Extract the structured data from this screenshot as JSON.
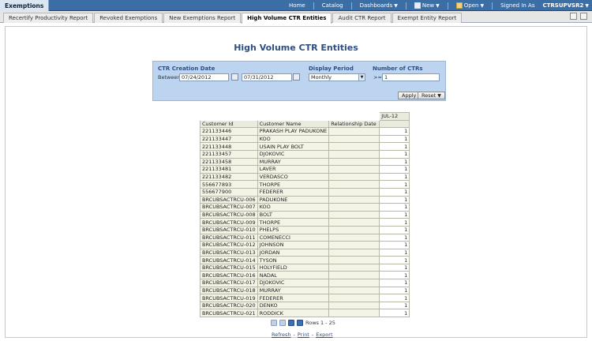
{
  "header": {
    "app_tab": "Exemptions",
    "nav": {
      "home": "Home",
      "catalog": "Catalog",
      "dashboards": "Dashboards",
      "new": "New",
      "open": "Open",
      "signed_in_as": "Signed In As",
      "user": "CTRSUPVSR2"
    }
  },
  "tabs": [
    {
      "label": "Recertify Productivity Report"
    },
    {
      "label": "Revoked Exemptions"
    },
    {
      "label": "New Exemptions Report"
    },
    {
      "label": "High Volume CTR Entities"
    },
    {
      "label": "Audit CTR Report"
    },
    {
      "label": "Exempt Entity Report"
    }
  ],
  "active_tab": "High Volume CTR Entities",
  "page": {
    "title": "High Volume CTR Entities"
  },
  "filters": {
    "ctr_date_label": "CTR Creation Date",
    "between_label": "Between",
    "date_from": "07/24/2012",
    "date_to": "07/31/2012",
    "display_period_label": "Display Period",
    "display_period_value": "Monthly",
    "num_ctrs_label": "Number of CTRs",
    "num_ctrs_op": ">=",
    "num_ctrs_value": "1",
    "apply_label": "Apply",
    "reset_label": "Reset"
  },
  "table": {
    "period_header": "JUL-12",
    "columns": [
      "Customer Id",
      "Customer Name",
      "Relationship Date"
    ],
    "rows": [
      [
        "221133446",
        "PRAKASH PLAY PADUKONE",
        "",
        "1"
      ],
      [
        "221133447",
        "KOO",
        "",
        "1"
      ],
      [
        "221133448",
        "USAIN PLAY BOLT",
        "",
        "1"
      ],
      [
        "221133457",
        "DJOKOVIC",
        "",
        "1"
      ],
      [
        "221133458",
        "MURRAY",
        "",
        "1"
      ],
      [
        "221133481",
        "LAVER",
        "",
        "1"
      ],
      [
        "221133482",
        "VERDASCO",
        "",
        "1"
      ],
      [
        "556677893",
        "THORPE",
        "",
        "1"
      ],
      [
        "556677900",
        "FEDERER",
        "",
        "1"
      ],
      [
        "BRCUBSACTRCU-006",
        "PADUKONE",
        "",
        "1"
      ],
      [
        "BRCUBSACTRCU-007",
        "KOO",
        "",
        "1"
      ],
      [
        "BRCUBSACTRCU-008",
        "BOLT",
        "",
        "1"
      ],
      [
        "BRCUBSACTRCU-009",
        "THORPE",
        "",
        "1"
      ],
      [
        "BRCUBSACTRCU-010",
        "PHELPS",
        "",
        "1"
      ],
      [
        "BRCUBSACTRCU-011",
        "COMENECCI",
        "",
        "1"
      ],
      [
        "BRCUBSACTRCU-012",
        "JOHNSON",
        "",
        "1"
      ],
      [
        "BRCUBSACTRCU-013",
        "JORDAN",
        "",
        "1"
      ],
      [
        "BRCUBSACTRCU-014",
        "TYSON",
        "",
        "1"
      ],
      [
        "BRCUBSACTRCU-015",
        "HOLYFIELD",
        "",
        "1"
      ],
      [
        "BRCUBSACTRCU-016",
        "NADAL",
        "",
        "1"
      ],
      [
        "BRCUBSACTRCU-017",
        "DJOKOVIC",
        "",
        "1"
      ],
      [
        "BRCUBSACTRCU-018",
        "MURRAY",
        "",
        "1"
      ],
      [
        "BRCUBSACTRCU-019",
        "FEDERER",
        "",
        "1"
      ],
      [
        "BRCUBSACTRCU-020",
        "DENKO",
        "",
        "1"
      ],
      [
        "BRCUBSACTRCU-021",
        "RODDICK",
        "",
        "1"
      ]
    ]
  },
  "pager": {
    "rows_text": "Rows 1 - 25"
  },
  "footer_links": {
    "refresh": "Refresh",
    "print": "Print",
    "export": "Export",
    "sep": "-"
  },
  "colors": {
    "header_blue": "#3a6ea5",
    "title_blue": "#2d4e83",
    "filter_bg": "#bcd4ef"
  }
}
